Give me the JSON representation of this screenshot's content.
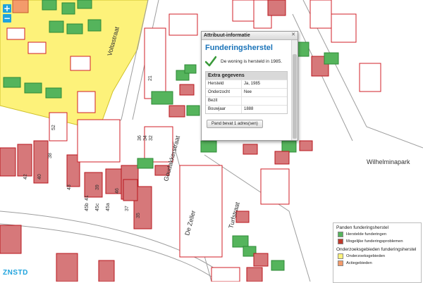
{
  "map": {
    "street_labels": [
      "Voltastraat",
      "Goudakkerstraat",
      "De Zeller",
      "Turfstraat",
      "Wilhelminapark"
    ],
    "parcel_numbers": [
      "42",
      "40",
      "38",
      "36",
      "34",
      "32",
      "52",
      "43",
      "41",
      "39",
      "45b",
      "45c",
      "45a",
      "46",
      "37",
      "35",
      "21"
    ],
    "colors": {
      "hersteld": "#55b45c",
      "mogelijk": "#d6787a",
      "onderzoek": "#fdf27a",
      "actie": "#f39b6b",
      "outline": "#d01f27",
      "accent": "#1fa3dd"
    }
  },
  "zoom": {
    "in_label": "+",
    "out_label": "−"
  },
  "popup": {
    "title": "Attribuut-informatie",
    "close_icon": "close-icon",
    "heading": "Funderingsherstel",
    "status_icon": "checkmark-icon",
    "status_text": "De woning is hersteld in 1985.",
    "section_title": "Extra gegevens",
    "rows": [
      {
        "key": "Hersteld",
        "value": "Ja, 1985"
      },
      {
        "key": "Onderzocht",
        "value": "Nee"
      },
      {
        "key": "Bezit",
        "value": ""
      },
      {
        "key": "Bouwjaar",
        "value": "1888"
      }
    ],
    "button_label": "Pand bevat 1 adres(sen)"
  },
  "legend": {
    "title1": "Panden funderingsherstel",
    "items1": [
      {
        "label": "Herstelde funderingen",
        "color": "#55b45c"
      },
      {
        "label": "Mogelijke funderingsproblemen",
        "color": "#c0392b"
      }
    ],
    "title2": "Onderzoeksgebieden funderingsherstel",
    "items2": [
      {
        "label": "Onderzoeksgebieden",
        "color": "#fdf27a"
      },
      {
        "label": "Actiegebieden",
        "color": "#f39b6b"
      }
    ]
  },
  "logo": "ZNSTD"
}
